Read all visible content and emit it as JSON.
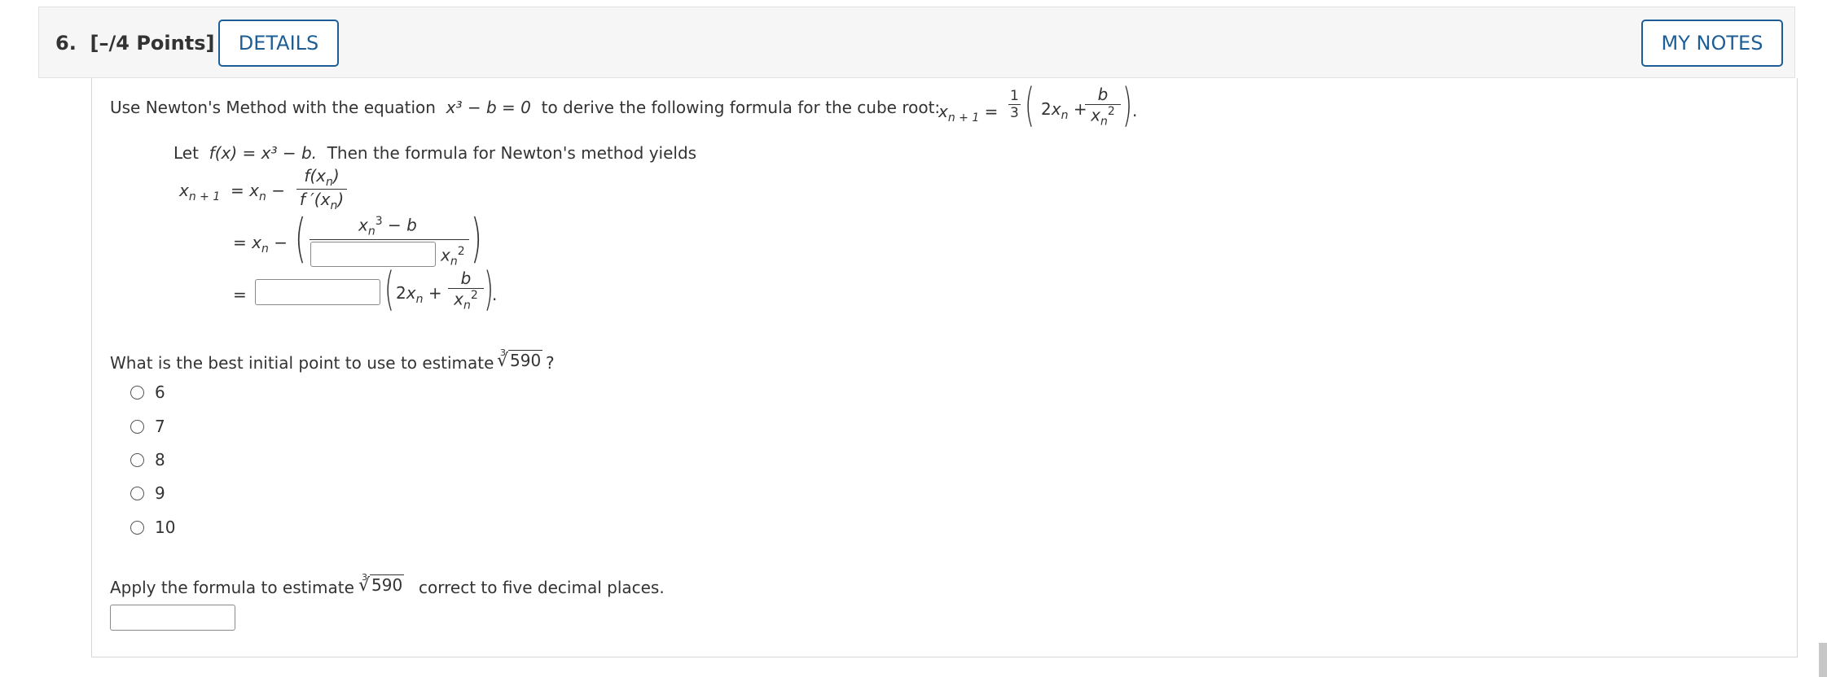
{
  "question": {
    "number_label": "6.",
    "points_label": "[–/4 Points]",
    "details_button": "DETAILS",
    "notes_button": "MY NOTES"
  },
  "intro": {
    "text_before": "Use Newton's Method with the equation",
    "equation": "x³ − b = 0",
    "text_after": "to derive the following formula for the cube root:"
  },
  "derivation": {
    "let_text": "Let",
    "f_def": "f(x) = x³ − b.",
    "then_text": "Then the formula for Newton's method yields",
    "step3_tail": "."
  },
  "initial_point": {
    "question_before": "What is the best initial point to use to estimate",
    "radicand": "590",
    "question_after": "?",
    "options": [
      "6",
      "7",
      "8",
      "9",
      "10"
    ]
  },
  "estimate": {
    "text_before": "Apply the formula to estimate",
    "radicand": "590",
    "text_after": "correct to five decimal places."
  }
}
